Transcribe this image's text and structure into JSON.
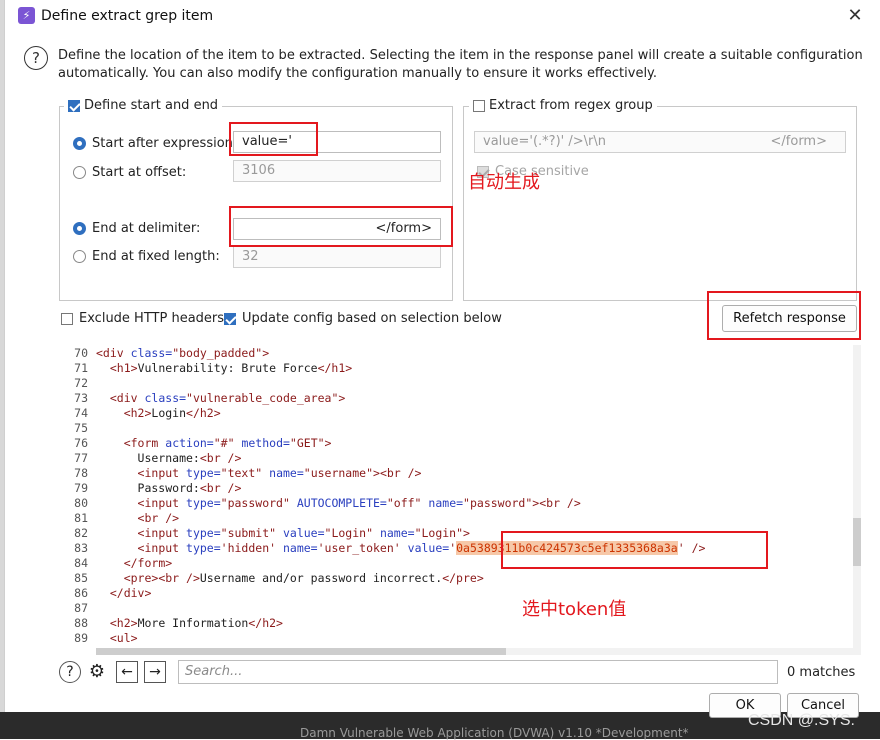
{
  "dialog": {
    "title": "Define extract grep item",
    "close_label": "X",
    "help_label": "?"
  },
  "description": {
    "line1": "Define the location of the item to be extracted. Selecting the item in the response panel will create a suitable configuration",
    "line2": "automatically. You can also modify the configuration manually to ensure it works effectively."
  },
  "start_end_group": {
    "legend": "Define start and end",
    "checked": true,
    "start_after_label": "Start after expression:",
    "start_after_value": "value='",
    "start_offset_label": "Start at offset:",
    "start_offset_value": "3106",
    "end_delim_label": "End at delimiter:",
    "end_delim_value": "</form>",
    "end_fixed_label": "End at fixed length:",
    "end_fixed_value": "32"
  },
  "regex_group": {
    "legend": "Extract from regex group",
    "checked": false,
    "regex_left": "value='(.*?)' />\\r\\n",
    "regex_right": "</form>",
    "case_label": "Case sensitive"
  },
  "options": {
    "exclude_headers_label": "Exclude HTTP headers",
    "exclude_headers_checked": false,
    "update_config_label": "Update config based on selection below",
    "update_config_checked": true,
    "refetch_label": "Refetch response"
  },
  "code": {
    "line_numbers": [
      "70",
      "71",
      "72",
      "73",
      "74",
      "75",
      "76",
      "77",
      "78",
      "79",
      "80",
      "81",
      "82",
      "83",
      "84",
      "85",
      "86",
      "87",
      "88",
      "89"
    ],
    "selected_token": "0a5389311b0c424573c5ef1335368a3a"
  },
  "search": {
    "placeholder": "Search...",
    "matches": "0 matches",
    "back_icon": "arrow-left-icon",
    "forward_icon": "arrow-right-icon",
    "settings_icon": "gear-icon"
  },
  "buttons": {
    "ok": "OK",
    "cancel": "Cancel"
  },
  "annotations": {
    "auto_generated": "自动生成",
    "select_token": "选中token值",
    "color": "#e3181e"
  },
  "background": {
    "window_title": "Damn Vulnerable Web Application (DVWA) v1.10 *Development*",
    "watermark": "CSDN @.SYS."
  },
  "colors": {
    "accent": "#2f6fbf",
    "tag": "#8b1a1a",
    "attr": "#2a3fbf",
    "selection_bg": "#f6c8a8"
  }
}
